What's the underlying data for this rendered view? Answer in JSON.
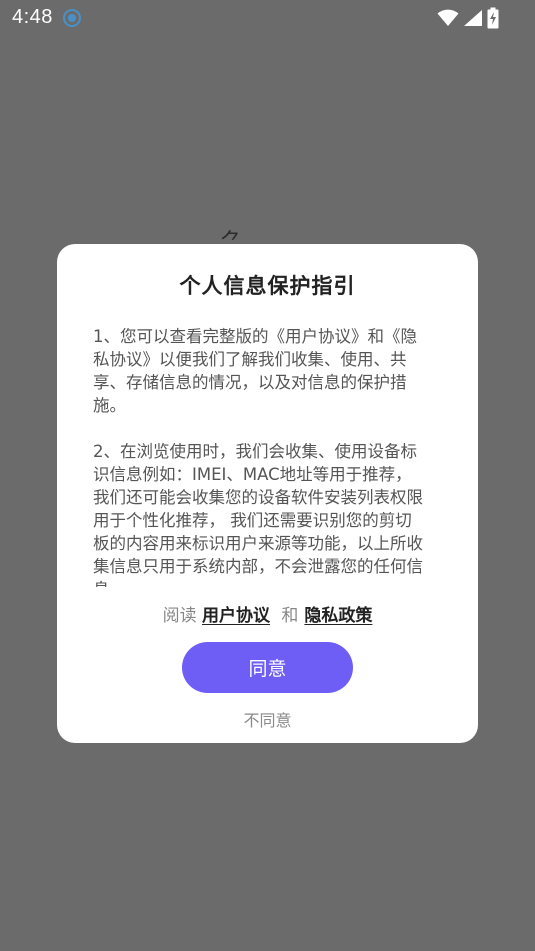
{
  "status_bar": {
    "time": "4:48"
  },
  "dialog": {
    "title": "个人信息保护指引",
    "body": {
      "paragraph_1": "1、您可以查看完整版的《用户协议》和《隐\n私协议》以便我们了解我们收集、使用、共\n享、存储信息的情况，以及对信息的保护措\n施。",
      "paragraph_2": "2、在浏览使用时，我们会收集、使用设备标\n识信息例如：IMEI、MAC地址等用于推荐，\n我们还可能会收集您的设备软件安装列表权限\n用于个性化推荐， 我们还需要识别您的剪切\n板的内容用来标识用户来源等功能，以上所收\n集信息只用于系统内部，不会泄露您的任何信\n息"
    },
    "links": {
      "prefix": "阅读",
      "user_agreement": "用户协议",
      "and": "和",
      "privacy_policy": "隐私政策"
    },
    "agree_label": "同意",
    "disagree_label": "不同意"
  },
  "colors": {
    "overlay": "#6b6b6b",
    "accent": "#6e5ef5",
    "dialog_bg": "#ffffff"
  }
}
